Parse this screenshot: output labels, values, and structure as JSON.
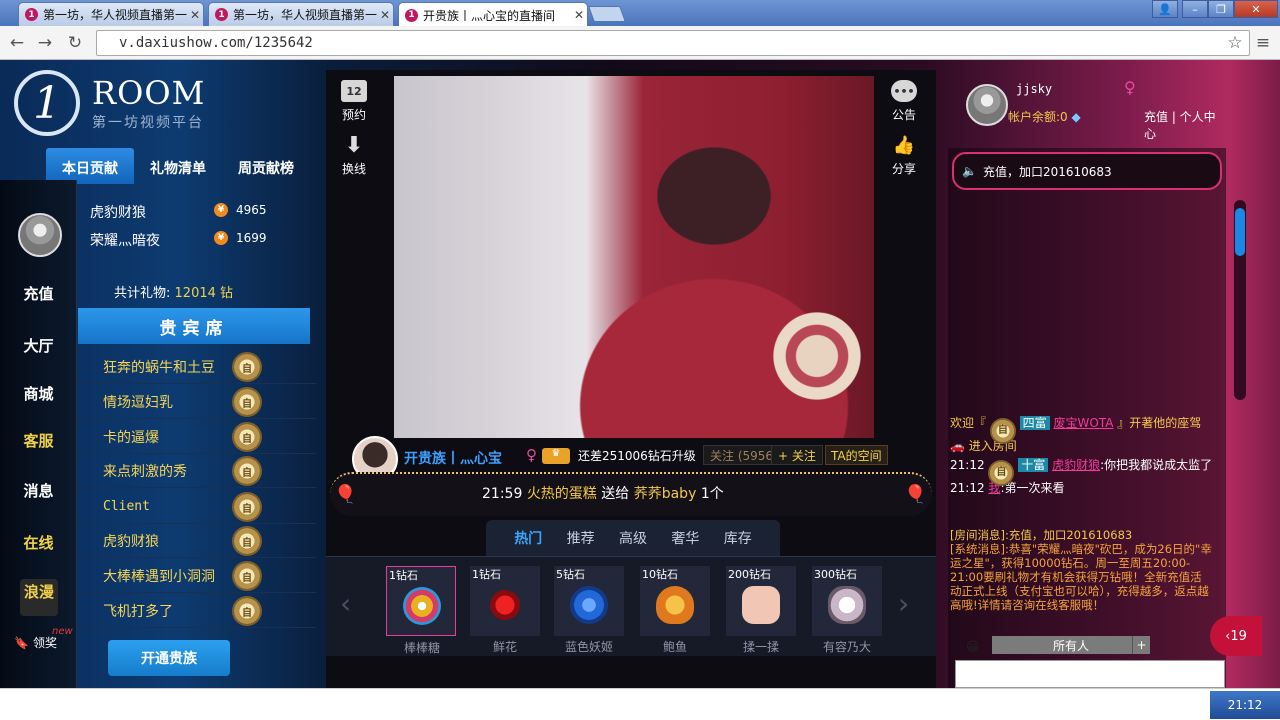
{
  "browser": {
    "tabs": [
      {
        "label": "第一坊，华人视频直播第一",
        "active": false
      },
      {
        "label": "第一坊，华人视频直播第一",
        "active": false
      },
      {
        "label": "开贵族丨灬心宝的直播间",
        "active": true
      }
    ],
    "url": "v.daxiushow.com/1235642",
    "window_buttons": [
      "person-icon",
      "minimize-icon",
      "restore-icon",
      "close-icon"
    ]
  },
  "site": {
    "logo_mark": "1",
    "logo_room": "ROOM",
    "logo_sub": "第一坊视频平台"
  },
  "sidenav": {
    "items": [
      {
        "label": "充值",
        "gold": false
      },
      {
        "label": "大厅",
        "gold": false
      },
      {
        "label": "商城",
        "gold": false
      },
      {
        "label": "客服",
        "gold": true
      },
      {
        "label": "消息",
        "gold": false
      },
      {
        "label": "在线",
        "gold": true
      },
      {
        "label": "浪漫",
        "gold": true
      }
    ],
    "award_label": "领奖",
    "award_new": "new"
  },
  "left_panel": {
    "tabs": [
      "本日贡献",
      "礼物清单",
      "周贡献榜"
    ],
    "ranking": [
      {
        "name": "虎豹财狼",
        "value": "4965"
      },
      {
        "name": "荣耀灬暗夜",
        "value": "1699"
      }
    ],
    "coin_icon": "¥",
    "total_label": "共计礼物:",
    "total_value": "12014 钻",
    "vip_title": "贵宾席",
    "vip_list": [
      "狂奔的蜗牛和土豆",
      "情场逗妇乳",
      "卡的逼爆",
      "来点刺激的秀",
      "Client",
      "虎豹财狼",
      "大棒棒遇到小洞洞",
      "飞机打多了"
    ],
    "vip_badge_char": "自",
    "open_noble_button": "开通贵族"
  },
  "center": {
    "left_buttons": [
      {
        "icon": "calendar-icon",
        "icon_text": "12",
        "label": "预约"
      },
      {
        "icon": "download-arrow-icon",
        "icon_text": "⬇",
        "label": "换线"
      }
    ],
    "right_buttons": [
      {
        "icon": "chat-bubble-icon",
        "icon_text": "•••",
        "label": "公告"
      },
      {
        "icon": "thumbs-up-icon",
        "icon_text": "👍",
        "label": "分享"
      }
    ],
    "streamer_name": "开贵族丨灬心宝",
    "upgrade_text": "还差251006钻石升级",
    "fans_text": "关注 (5956)",
    "follow_button": "+ 关注",
    "space_button": "TA的空间",
    "ticker": {
      "time": "21:59",
      "text": "火热的蛋糕",
      "verb": "送给",
      "target": "荞荞baby",
      "count": "1个"
    },
    "gift_tabs": [
      "热门",
      "推荐",
      "高级",
      "奢华",
      "库存"
    ],
    "gifts": [
      {
        "price": "1钻石",
        "name": "棒棒糖",
        "color": "#e9b020"
      },
      {
        "price": "1钻石",
        "name": "鲜花",
        "color": "#c0141e"
      },
      {
        "price": "5钻石",
        "name": "蓝色妖姬",
        "color": "#2268d8"
      },
      {
        "price": "10钻石",
        "name": "鲍鱼",
        "color": "#e79a2a"
      },
      {
        "price": "200钻石",
        "name": "揉一揉",
        "color": "#f2c6b4"
      },
      {
        "price": "300钻石",
        "name": "有容乃大",
        "color": "#e8dde8"
      }
    ]
  },
  "right": {
    "username": "jjsky",
    "balance": "帐户余额:0",
    "links": "充值 | 个人中心",
    "notice": "充值，加口201610683",
    "chat": [
      {
        "prefix": "欢迎『",
        "rank": "四富",
        "name": "废宝WOTA",
        "suffix": "』开著他的座驾",
        "line2": "进入房间"
      },
      {
        "time": "21:12",
        "rank": "十富",
        "name": "虎豹财狼",
        "text": ":你把我都说成太监了"
      },
      {
        "time": "21:12",
        "name": "我",
        "text": ":第一次来看"
      }
    ],
    "sys_room": "[房间消息]:充值，加口201610683",
    "sys_msg": "[系统消息]:恭喜\"荣耀灬暗夜\"砍巴，成为26日的\"幸运之星\"，获得10000钻石。周一至周五20:00-21:00要刷礼物才有机会获得万钻哦！全新充值活动正式上线（支付宝也可以哈），充得越多，返点越高哦!详情请咨询在线客服哦！",
    "to_all": "所有人",
    "side_count": "19"
  },
  "taskbar": {
    "clock": "21:12"
  }
}
